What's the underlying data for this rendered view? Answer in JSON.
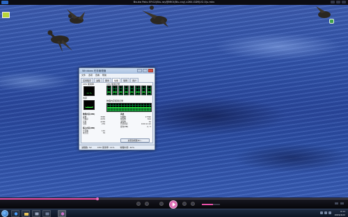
{
  "window": {
    "title": "Bvuka Paku EP.02(Blu-ray@MKV(Blu-ray).x264.GDR(V2.0)s.mkv"
  },
  "video": {
    "scene": "ducks-over-river"
  },
  "task_manager": {
    "title": "Windows 任务管理器",
    "menu": [
      "文件",
      "选项",
      "查看",
      "帮助"
    ],
    "tabs": [
      {
        "label": "应用程序",
        "active": false
      },
      {
        "label": "进程",
        "active": false
      },
      {
        "label": "服务",
        "active": false
      },
      {
        "label": "性能",
        "active": true
      },
      {
        "label": "联网",
        "active": false
      },
      {
        "label": "用户",
        "active": false
      }
    ],
    "cpu_usage_label": "CPU 使用率",
    "cpu_history_label": "CPU 使用记录",
    "cpu_value": "11 %",
    "cpu_fraction": 0.11,
    "mem_label": "内存",
    "mem_history_label": "物理内存使用记录",
    "mem_value": "1.63 GB",
    "mem_fraction": 0.42,
    "physical_memory": {
      "header": "物理内存(MB)",
      "rows": [
        {
          "k": "总数",
          "v": "3990"
        },
        {
          "k": "已缓存",
          "v": "2076"
        },
        {
          "k": "可用",
          "v": "2299"
        },
        {
          "k": "空闲",
          "v": "276"
        }
      ]
    },
    "kernel_memory": {
      "header": "核心内存(MB)",
      "rows": [
        {
          "k": "分页数",
          "v": "191"
        },
        {
          "k": "未分页",
          "v": "76"
        }
      ]
    },
    "system": {
      "header": "系统",
      "rows": [
        {
          "k": "句柄数",
          "v": "17396"
        },
        {
          "k": "线程数",
          "v": "812"
        },
        {
          "k": "进程数",
          "v": "52"
        },
        {
          "k": "开机时间",
          "v": "0:00:11:22"
        },
        {
          "k": "提交(MB)",
          "v": "2 / 7"
        }
      ]
    },
    "resource_monitor_button": "资源监视器(R)...",
    "status": {
      "processes": "进程数: 52",
      "cpu": "CPU 使用率: 11%",
      "memory": "物理内存: 42%"
    }
  },
  "player": {
    "progress_fraction": 0.28,
    "volume_fraction": 0.6
  },
  "taskbar": {
    "clock_time": "0:11",
    "clock_date": "2009/4/22"
  },
  "colors": {
    "accent": "#e850a8",
    "graph_green": "#2ef03a"
  }
}
